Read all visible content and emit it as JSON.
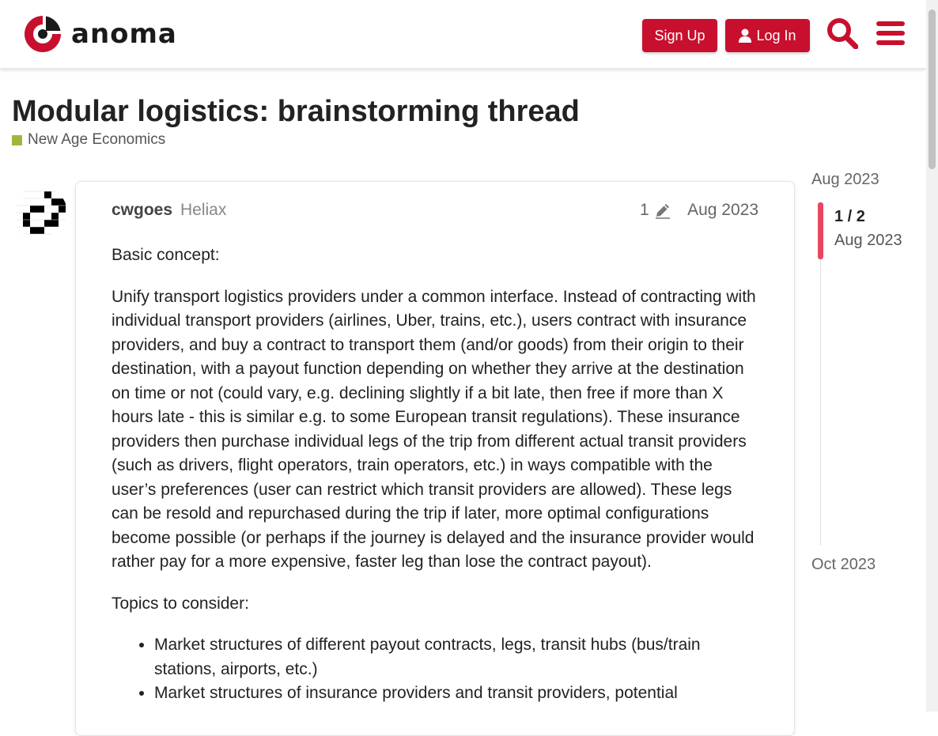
{
  "header": {
    "logo_text": "anoma",
    "signup_label": "Sign Up",
    "login_label": "Log In"
  },
  "topic": {
    "title": "Modular logistics: brainstorming thread",
    "category": "New Age Economics",
    "category_color": "#9eb83b"
  },
  "post": {
    "username": "cwgoes",
    "user_title": "Heliax",
    "edit_count": "1",
    "date": "Aug 2023",
    "paragraphs": [
      "Basic concept:",
      "Unify transport logistics providers under a common interface. Instead of contracting with individual transport providers (airlines, Uber, trains, etc.), users contract with insurance providers, and buy a contract to transport them (and/or goods) from their origin to their destination, with a payout function depending on whether they arrive at the destination on time or not (could vary, e.g. declining slightly if a bit late, then free if more than X hours late - this is similar e.g. to some European transit regulations). These insurance providers then purchase individual legs of the trip from different actual transit providers (such as drivers, flight operators, train operators, etc.) in ways compatible with the user’s preferences (user can restrict which transit providers are allowed). These legs can be resold and repurchased during the trip if later, more optimal configurations become possible (or perhaps if the journey is delayed and the insurance provider would rather pay for a more expensive, faster leg than lose the contract payout).",
      "Topics to consider:"
    ],
    "list_items": [
      "Market structures of different payout contracts, legs, transit hubs (bus/train stations, airports, etc.)",
      "Market structures of insurance providers and transit providers, potential"
    ]
  },
  "timeline": {
    "top_date": "Aug 2023",
    "position": "1 / 2",
    "position_date": "Aug 2023",
    "bottom_date": "Oct 2023"
  },
  "colors": {
    "brand_red": "#c8102e",
    "timeline_handle": "#e8475f"
  }
}
